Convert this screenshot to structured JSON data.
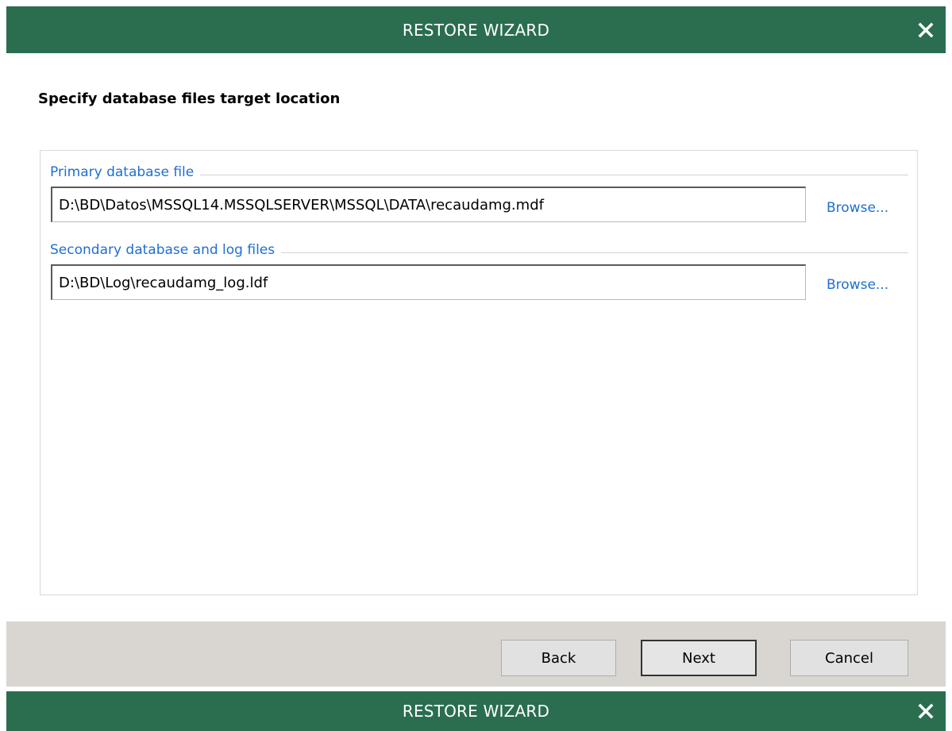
{
  "window": {
    "title": "RESTORE WIZARD",
    "bottom_title": "RESTORE WIZARD",
    "accent_color": "#2a6d4f"
  },
  "page": {
    "heading": "Specify database files target location"
  },
  "primary": {
    "group_label": "Primary database file",
    "path_value": "D:\\BD\\Datos\\MSSQL14.MSSQLSERVER\\MSSQL\\DATA\\recaudamg.mdf",
    "browse_label": "Browse..."
  },
  "secondary": {
    "group_label": "Secondary database and log files",
    "path_value": "D:\\BD\\Log\\recaudamg_log.ldf",
    "browse_label": "Browse..."
  },
  "footer": {
    "back_label": "Back",
    "next_label": "Next",
    "cancel_label": "Cancel"
  },
  "icons": {
    "close": "close-icon"
  }
}
